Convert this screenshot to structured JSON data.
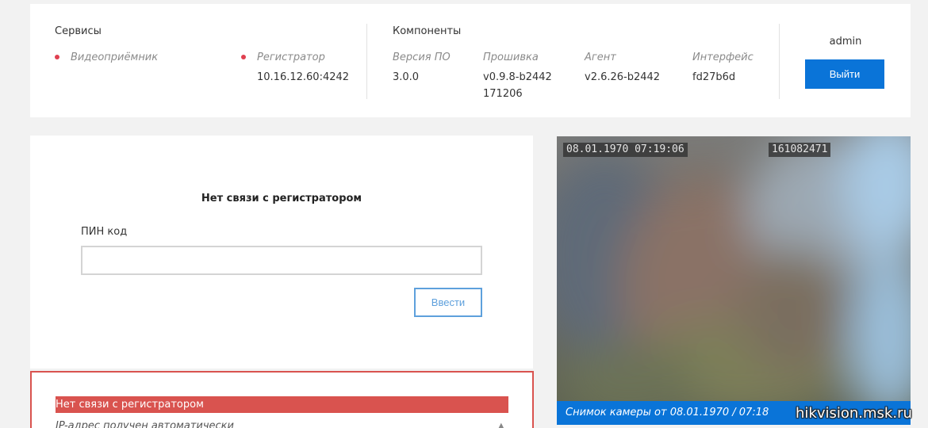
{
  "services": {
    "title": "Сервисы",
    "items": [
      {
        "label": "Видеоприёмник",
        "value": "",
        "status_color": "#e04050"
      },
      {
        "label": "Регистратор",
        "value": "10.16.12.60:4242",
        "status_color": "#e04050"
      }
    ]
  },
  "components": {
    "title": "Компоненты",
    "items": [
      {
        "label": "Версия ПО",
        "value": "3.0.0",
        "value2": ""
      },
      {
        "label": "Прошивка",
        "value": "v0.9.8-b2442",
        "value2": "171206"
      },
      {
        "label": "Агент",
        "value": "v2.6.26-b2442",
        "value2": ""
      },
      {
        "label": "Интерфейс",
        "value": "fd27b6d",
        "value2": ""
      }
    ]
  },
  "user": {
    "name": "admin",
    "logout_label": "Выйти"
  },
  "pin": {
    "heading": "Нет связи с регистратором",
    "label": "ПИН код",
    "value": "",
    "submit_label": "Ввести"
  },
  "status": {
    "error_text": "Нет связи с регистратором",
    "line": "IP-адрес получен автоматически"
  },
  "camera": {
    "osd_datetime": "08.01.1970 07:19:06",
    "osd_id": "161082471",
    "caption": "Снимок камеры от 08.01.1970 / 07:18"
  },
  "watermark": "hikvision.msk.ru",
  "colors": {
    "accent": "#0a74d8",
    "error": "#d9534f",
    "status_dot": "#e04050"
  }
}
